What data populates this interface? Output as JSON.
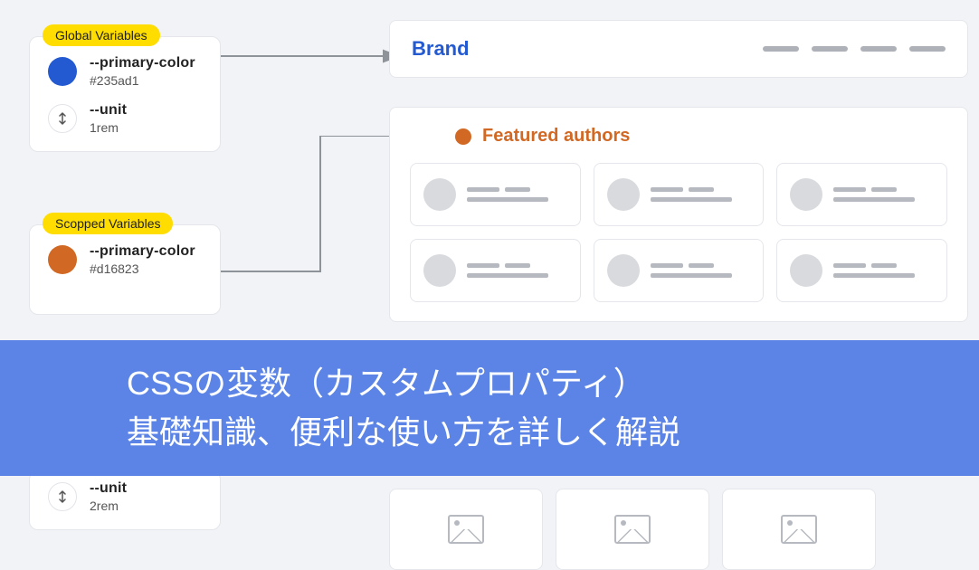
{
  "global_card": {
    "badge": "Global Variables",
    "primary": {
      "name": "--primary-color",
      "value": "#235ad1",
      "swatch": "#235ad1"
    },
    "unit": {
      "name": "--unit",
      "value": "1rem"
    }
  },
  "scoped_card": {
    "badge": "Scopped Variables",
    "primary": {
      "name": "--primary-color",
      "value": "#d16823",
      "swatch": "#d16823"
    },
    "unit": {
      "name": "--unit",
      "value": "2rem"
    }
  },
  "brand": {
    "label": "Brand"
  },
  "authors": {
    "title": "Featured authors"
  },
  "overlay": {
    "line1": "CSSの変数（カスタムプロパティ）",
    "line2": "基礎知識、便利な使い方を詳しく解説"
  },
  "colors": {
    "primary_blue": "#235ad1",
    "accent_orange": "#d16823",
    "badge_yellow": "#ffdd00",
    "overlay_blue": "#5b84e6"
  }
}
